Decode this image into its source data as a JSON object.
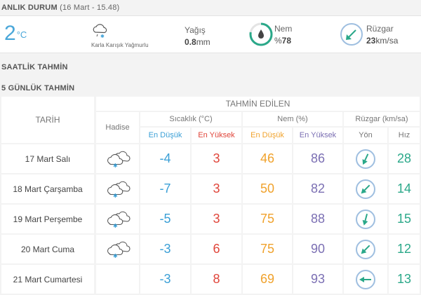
{
  "current": {
    "title": "ANLIK DURUM",
    "time": "(16 Mart - 15.48)",
    "temp": "2",
    "temp_unit": "°C",
    "hadise_icon": "snow-rain-cloud-icon",
    "hadise_text": "Karla Karışık Yağmurlu",
    "yagis_label": "Yağış",
    "yagis_value": "0.8",
    "yagis_unit": "mm",
    "nem_label": "Nem",
    "nem_prefix": "%",
    "nem_value": "78",
    "nem_fraction": 0.78,
    "ruzgar_label": "Rüzgar",
    "ruzgar_value": "23",
    "ruzgar_unit": "km/sa"
  },
  "saatlik_title": "SAATLİK TAHMİN",
  "gunluk_title": "5 GÜNLÜK TAHMİN",
  "table": {
    "h_tarih": "TARİH",
    "h_tahmin": "TAHMİN EDİLEN",
    "h_hadise": "Hadise",
    "h_sicaklik": "Sıcaklık (°C)",
    "h_nem": "Nem (%)",
    "h_ruzgar": "Rüzgar (km/sa)",
    "h_en_dusuk": "En Düşük",
    "h_en_yuksek": "En Yüksek",
    "h_yon": "Yön",
    "h_hiz": "Hız"
  },
  "days": [
    {
      "date": "17 Mart Salı",
      "hadise_icon": "snow-cloud-icon",
      "t_min": "-4",
      "t_max": "3",
      "h_min": "46",
      "h_max": "86",
      "wind_icon": "wind-direction-icon",
      "wind_speed": "28"
    },
    {
      "date": "18 Mart Çarşamba",
      "hadise_icon": "snow-cloud-icon",
      "t_min": "-7",
      "t_max": "3",
      "h_min": "50",
      "h_max": "82",
      "wind_icon": "wind-direction-icon",
      "wind_speed": "14"
    },
    {
      "date": "19 Mart Perşembe",
      "hadise_icon": "snow-cloud-icon",
      "t_min": "-5",
      "t_max": "3",
      "h_min": "75",
      "h_max": "88",
      "wind_icon": "wind-direction-icon",
      "wind_speed": "15"
    },
    {
      "date": "20 Mart Cuma",
      "hadise_icon": "snow-cloud-icon",
      "t_min": "-3",
      "t_max": "6",
      "h_min": "75",
      "h_max": "90",
      "wind_icon": "wind-direction-icon",
      "wind_speed": "12"
    },
    {
      "date": "21 Mart Cumartesi",
      "hadise_icon": "",
      "t_min": "-3",
      "t_max": "8",
      "h_min": "69",
      "h_max": "93",
      "wind_icon": "wind-direction-icon",
      "wind_speed": "13"
    }
  ]
}
